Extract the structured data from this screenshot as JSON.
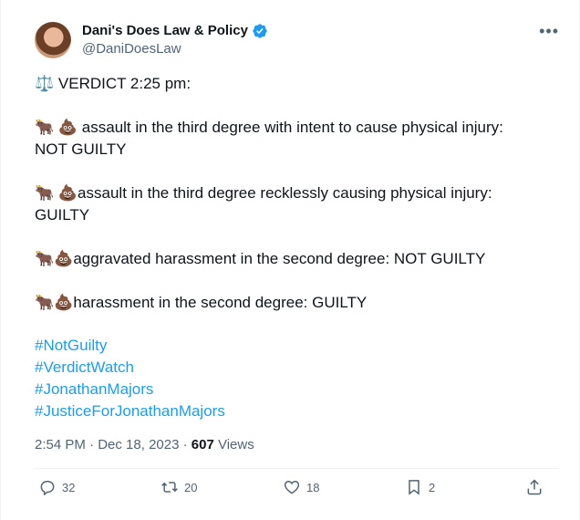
{
  "author": {
    "name": "Dani's Does Law & Policy",
    "handle": "@DaniDoesLaw"
  },
  "tweet": {
    "line1": "⚖️ VERDICT 2:25 pm:",
    "line2a": "🐂 💩 assault in the third degree with intent to cause physical injury:",
    "line2b": "NOT GUILTY",
    "line3a": "🐂 💩assault in the third degree recklessly causing physical injury:",
    "line3b": "GUILTY",
    "line4": "🐂💩aggravated harassment in the second degree:  NOT GUILTY",
    "line5": "🐂💩harassment in the second degree:  GUILTY",
    "hashtags": [
      "#NotGuilty",
      "#VerdictWatch",
      "#JonathanMajors",
      "#JusticeForJonathanMajors"
    ]
  },
  "meta": {
    "time": "2:54 PM",
    "sep": " · ",
    "date": "Dec 18, 2023",
    "views_count": "607",
    "views_label": " Views"
  },
  "actions": {
    "reply_count": "32",
    "retweet_count": "20",
    "like_count": "18",
    "bookmark_count": "2"
  },
  "colors": {
    "accent": "#1d9bf0",
    "secondary_text": "#536471",
    "primary_text": "#0f1419"
  }
}
